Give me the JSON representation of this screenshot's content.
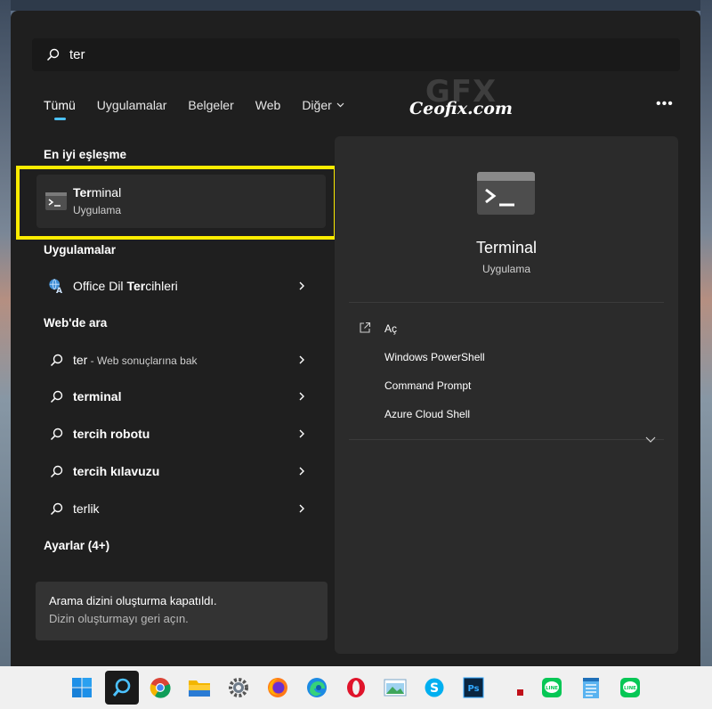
{
  "search": {
    "value": "ter",
    "icon": "search-icon"
  },
  "tabs": [
    {
      "label": "Tümü"
    },
    {
      "label": "Uygulamalar"
    },
    {
      "label": "Belgeler"
    },
    {
      "label": "Web"
    },
    {
      "label": "Diğer"
    }
  ],
  "more_options": "•••",
  "watermark": {
    "logo": "GFX",
    "text": "Ceofix.com"
  },
  "left": {
    "best_match_title": "En iyi eşleşme",
    "best_match": {
      "name_bold": "Ter",
      "name_rest": "minal",
      "type": "Uygulama"
    },
    "apps_title": "Uygulamalar",
    "apps": [
      {
        "pre": "Office Dil ",
        "bold": "Ter",
        "post": "cihleri"
      }
    ],
    "web_title": "Web'de ara",
    "web": [
      {
        "text": "ter",
        "suffix": " - Web sonuçlarına bak"
      },
      {
        "text": "terminal",
        "suffix": ""
      },
      {
        "text": "tercih robotu",
        "suffix": ""
      },
      {
        "text": "tercih kılavuzu",
        "suffix": ""
      },
      {
        "text": "terlik",
        "suffix": ""
      }
    ],
    "settings_title": "Ayarlar (4+)",
    "notice": {
      "line1": "Arama dizini oluşturma kapatıldı.",
      "line2": "Dizin oluşturmayı geri açın."
    }
  },
  "right": {
    "title": "Terminal",
    "subtitle": "Uygulama",
    "actions": [
      "Aç",
      "Windows PowerShell",
      "Command Prompt",
      "Azure Cloud Shell"
    ]
  },
  "taskbar": {
    "icons": [
      "windows-start-icon",
      "search-icon",
      "chrome-icon",
      "file-explorer-icon",
      "settings-icon",
      "firefox-icon",
      "edge-icon",
      "opera-icon",
      "photos-icon",
      "skype-icon",
      "photoshop-icon",
      "red-square-icon",
      "line-icon",
      "notepad-icon",
      "line-icon"
    ]
  },
  "colors": {
    "accent": "#4cc2ff",
    "highlight_box": "#fcec00",
    "panel": "#1f1f1f",
    "preview": "#2b2b2b"
  }
}
